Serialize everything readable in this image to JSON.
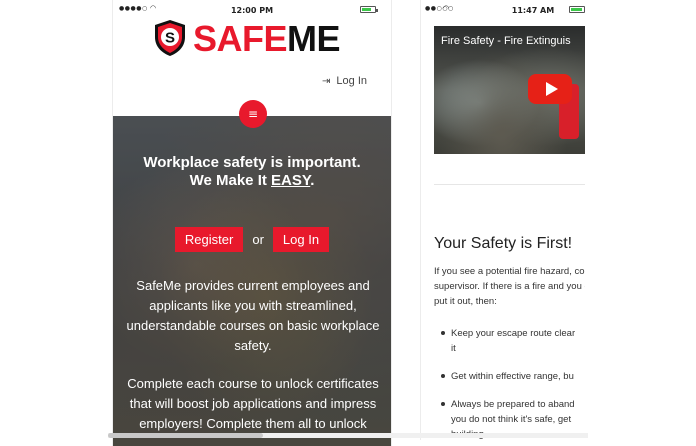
{
  "colors": {
    "brand_red": "#e8192c",
    "dark_text": "#111111",
    "youtube_red": "#e62117"
  },
  "left_phone": {
    "status": {
      "signal": "●●●●○",
      "wifi_icon": "wifi-icon",
      "time": "12:00 PM",
      "battery_icon": "battery-icon"
    },
    "logo": {
      "safe": "SAFE",
      "me": "ME",
      "shield_letter": "S"
    },
    "login_link": {
      "label": "Log In",
      "icon": "login-icon"
    },
    "menu_icon": "≡",
    "hero": {
      "heading_line1": "Workplace safety is important.",
      "heading_line2_prefix": "We Make It ",
      "heading_easy": "EASY",
      "heading_period": ".",
      "register_label": "Register",
      "or_label": "or",
      "login_label": "Log In",
      "para1_lines": [
        "SafeMe provides current employees and",
        "applicants like you with streamlined,",
        "understandable courses on basic workplace",
        "safety."
      ],
      "para2_lines": [
        "Complete each course to unlock certificates",
        "that will boost job applications and impress",
        "employers! Complete them all to unlock"
      ]
    }
  },
  "right_phone": {
    "status": {
      "signal": "●●○○○",
      "wifi_icon": "wifi-icon",
      "time": "11:47 AM",
      "battery_icon": "battery-icon"
    },
    "video": {
      "title": "Fire Safety - Fire Extinguis"
    },
    "section": {
      "title": "Your Safety is First!",
      "intro_lines": [
        "If you see a potential fire hazard, con",
        "supervisor. If there is a fire and you c",
        "put it out, then:"
      ],
      "bullets": [
        {
          "lines": [
            "Keep your escape route clear",
            "it"
          ]
        },
        {
          "lines": [
            "Get within effective range, bu"
          ]
        },
        {
          "lines": [
            "Always be prepared to aband",
            "you do not think it's safe, get",
            "building."
          ]
        }
      ]
    }
  }
}
